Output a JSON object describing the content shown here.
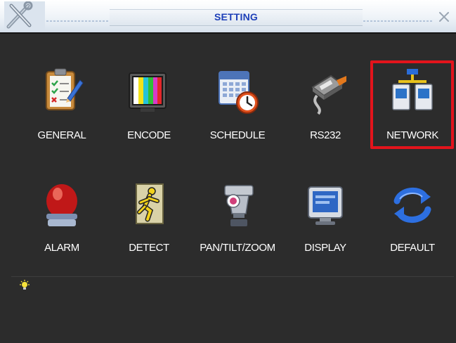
{
  "window": {
    "title": "SETTING",
    "close_icon": "close-x",
    "logo_icon": "tools-logo"
  },
  "menu_items": [
    {
      "label": "GENERAL",
      "icon": "clipboard-checklist-icon"
    },
    {
      "label": "ENCODE",
      "icon": "color-bars-monitor-icon"
    },
    {
      "label": "SCHEDULE",
      "icon": "calendar-clock-icon"
    },
    {
      "label": "RS232",
      "icon": "serial-cable-icon"
    },
    {
      "label": "NETWORK",
      "icon": "network-computers-icon",
      "highlighted": true
    },
    {
      "label": "ALARM",
      "icon": "red-alarm-light-icon"
    },
    {
      "label": "DETECT",
      "icon": "running-man-icon"
    },
    {
      "label": "PAN/TILT/ZOOM",
      "icon": "ptz-camera-icon"
    },
    {
      "label": "DISPLAY",
      "icon": "monitor-display-icon"
    },
    {
      "label": "DEFAULT",
      "icon": "refresh-arrows-icon"
    }
  ],
  "footer": {
    "hint_icon": "lightbulb-icon",
    "hint_text": ""
  },
  "colors": {
    "background": "#2c2c2c",
    "title_text": "#1d3fb8",
    "highlight_border": "#e3141c"
  }
}
